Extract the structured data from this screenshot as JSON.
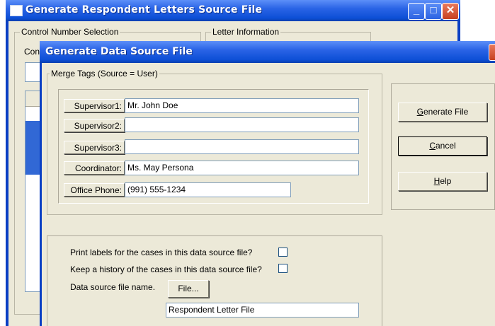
{
  "background_window": {
    "title": "Generate Respondent Letters Source File",
    "control_group_label": "Control Number Selection",
    "control_partial_label": "Con",
    "letter_group_label": "Letter Information",
    "minimize_glyph": "_",
    "maximize_glyph": "□",
    "close_glyph": "✕"
  },
  "dialog": {
    "title": "Generate Data Source File",
    "merge_group_label": "Merge Tags (Source = User)",
    "fields": [
      {
        "label": "Supervisor1:",
        "value": "Mr. John Doe"
      },
      {
        "label": "Supervisor2:",
        "value": ""
      },
      {
        "label": "Supervisor3:",
        "value": ""
      },
      {
        "label": "Coordinator:",
        "value": "Ms. May Persona"
      },
      {
        "label": "Office Phone:",
        "value": "(991) 555-1234"
      }
    ],
    "buttons": {
      "generate": "Generate File",
      "cancel": "Cancel",
      "help": "Help"
    },
    "options": {
      "print_labels": "Print labels for the cases in this data source file?",
      "keep_history": "Keep a history of the cases in this data source file?",
      "file_name_label": "Data source file name.",
      "file_button": "File...",
      "file_name_value": "Respondent Letter File"
    }
  },
  "colors": {
    "title_bar": "#0d4fd6",
    "dialog_face": "#ece9d8",
    "list_selection": "#3168d5"
  }
}
